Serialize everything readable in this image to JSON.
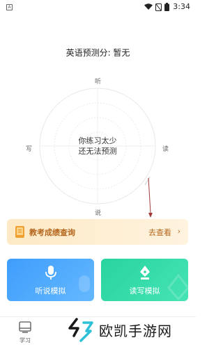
{
  "status_bar": {
    "app_badge": "A",
    "time": "3:34",
    "icons": [
      "wifi-icon",
      "sim-off-icon",
      "battery-icon"
    ]
  },
  "score": {
    "title": "英语预测分: 暂无"
  },
  "radar": {
    "center_line1": "你练习太少",
    "center_line2": "还无法预测",
    "axis_top": "听",
    "axis_left": "写",
    "axis_right": "读",
    "axis_bottom": "说"
  },
  "exam_query": {
    "label": "教考成绩查询",
    "action": "去查看",
    "chevron": "›",
    "accent": "#b5661d"
  },
  "cards": {
    "listen_label": "听说模拟",
    "write_label": "读写模拟",
    "listen_color": "#3f9dfb",
    "write_color": "#29d4a0"
  },
  "tab_bar": {
    "study_label": "学习"
  },
  "watermark": {
    "text": "欧凯手游网"
  }
}
